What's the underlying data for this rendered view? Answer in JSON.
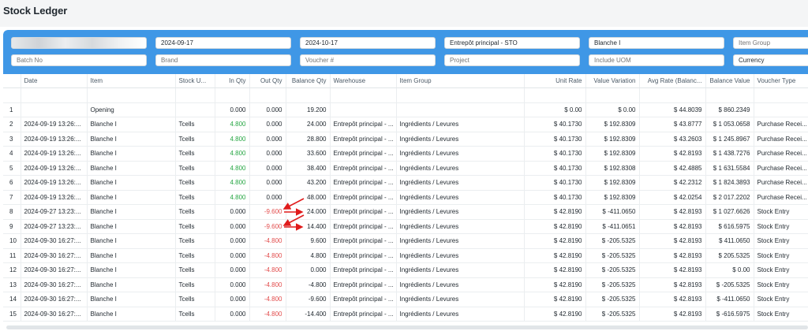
{
  "page": {
    "title": "Stock Ledger"
  },
  "filters": {
    "company": {
      "value": "Company",
      "blurred": true
    },
    "from_date": {
      "value": "2024-09-17"
    },
    "to_date": {
      "value": "2024-10-17"
    },
    "warehouse": {
      "value": "Entrepôt principal - STO"
    },
    "item": {
      "value": "Blanche I"
    },
    "item_group": {
      "placeholder": "Item Group"
    },
    "batch_no": {
      "placeholder": "Batch No"
    },
    "brand": {
      "placeholder": "Brand"
    },
    "voucher": {
      "placeholder": "Voucher #"
    },
    "project": {
      "placeholder": "Project"
    },
    "include_uom": {
      "placeholder": "Include UOM"
    },
    "currency": {
      "value": "Currency"
    }
  },
  "table": {
    "columns": [
      "",
      "Date",
      "Item",
      "Stock U...",
      "In Qty",
      "Out Qty",
      "Balance Qty",
      "Warehouse",
      "Item Group",
      "Unit Rate",
      "Value Variation",
      "Avg Rate (Balanc...",
      "Balance Value",
      "Voucher Type"
    ],
    "rows": [
      {
        "n": "1",
        "date": "",
        "item": "Opening",
        "uom": "",
        "in_qty": "0.000",
        "out_qty": "0.000",
        "bal_qty": "19.200",
        "warehouse": "",
        "item_group": "",
        "unit_rate": "$ 0.00",
        "value_var": "$ 0.00",
        "avg_rate": "$ 44.8039",
        "bal_value": "$ 860.2349",
        "voucher": ""
      },
      {
        "n": "2",
        "date": "2024-09-19 13:26:...",
        "item": "Blanche I",
        "uom": "Tcells",
        "in_qty": "4.800",
        "out_qty": "0.000",
        "bal_qty": "24.000",
        "warehouse": "Entrepôt principal - ...",
        "item_group": "Ingrédients / Levures",
        "unit_rate": "$ 40.1730",
        "value_var": "$ 192.8309",
        "avg_rate": "$ 43.8777",
        "bal_value": "$ 1 053.0658",
        "voucher": "Purchase Recei..."
      },
      {
        "n": "3",
        "date": "2024-09-19 13:26:...",
        "item": "Blanche I",
        "uom": "Tcells",
        "in_qty": "4.800",
        "out_qty": "0.000",
        "bal_qty": "28.800",
        "warehouse": "Entrepôt principal - ...",
        "item_group": "Ingrédients / Levures",
        "unit_rate": "$ 40.1730",
        "value_var": "$ 192.8309",
        "avg_rate": "$ 43.2603",
        "bal_value": "$ 1 245.8967",
        "voucher": "Purchase Recei..."
      },
      {
        "n": "4",
        "date": "2024-09-19 13:26:...",
        "item": "Blanche I",
        "uom": "Tcells",
        "in_qty": "4.800",
        "out_qty": "0.000",
        "bal_qty": "33.600",
        "warehouse": "Entrepôt principal - ...",
        "item_group": "Ingrédients / Levures",
        "unit_rate": "$ 40.1730",
        "value_var": "$ 192.8309",
        "avg_rate": "$ 42.8193",
        "bal_value": "$ 1 438.7276",
        "voucher": "Purchase Recei..."
      },
      {
        "n": "5",
        "date": "2024-09-19 13:26:...",
        "item": "Blanche I",
        "uom": "Tcells",
        "in_qty": "4.800",
        "out_qty": "0.000",
        "bal_qty": "38.400",
        "warehouse": "Entrepôt principal - ...",
        "item_group": "Ingrédients / Levures",
        "unit_rate": "$ 40.1730",
        "value_var": "$ 192.8308",
        "avg_rate": "$ 42.4885",
        "bal_value": "$ 1 631.5584",
        "voucher": "Purchase Recei..."
      },
      {
        "n": "6",
        "date": "2024-09-19 13:26:...",
        "item": "Blanche I",
        "uom": "Tcells",
        "in_qty": "4.800",
        "out_qty": "0.000",
        "bal_qty": "43.200",
        "warehouse": "Entrepôt principal - ...",
        "item_group": "Ingrédients / Levures",
        "unit_rate": "$ 40.1730",
        "value_var": "$ 192.8309",
        "avg_rate": "$ 42.2312",
        "bal_value": "$ 1 824.3893",
        "voucher": "Purchase Recei..."
      },
      {
        "n": "7",
        "date": "2024-09-19 13:26:...",
        "item": "Blanche I",
        "uom": "Tcells",
        "in_qty": "4.800",
        "out_qty": "0.000",
        "bal_qty": "48.000",
        "warehouse": "Entrepôt principal - ...",
        "item_group": "Ingrédients / Levures",
        "unit_rate": "$ 40.1730",
        "value_var": "$ 192.8309",
        "avg_rate": "$ 42.0254",
        "bal_value": "$ 2 017.2202",
        "voucher": "Purchase Recei..."
      },
      {
        "n": "8",
        "date": "2024-09-27 13:23:...",
        "item": "Blanche I",
        "uom": "Tcells",
        "in_qty": "0.000",
        "out_qty": "-9.600",
        "bal_qty": "24.000",
        "warehouse": "Entrepôt principal - ...",
        "item_group": "Ingrédients / Levures",
        "unit_rate": "$ 42.8190",
        "value_var": "$ -411.0650",
        "avg_rate": "$ 42.8193",
        "bal_value": "$ 1 027.6626",
        "voucher": "Stock Entry"
      },
      {
        "n": "9",
        "date": "2024-09-27 13:23:...",
        "item": "Blanche I",
        "uom": "Tcells",
        "in_qty": "0.000",
        "out_qty": "-9.600",
        "bal_qty": "14.400",
        "warehouse": "Entrepôt principal - ...",
        "item_group": "Ingrédients / Levures",
        "unit_rate": "$ 42.8190",
        "value_var": "$ -411.0651",
        "avg_rate": "$ 42.8193",
        "bal_value": "$ 616.5975",
        "voucher": "Stock Entry"
      },
      {
        "n": "10",
        "date": "2024-09-30 16:27:...",
        "item": "Blanche I",
        "uom": "Tcells",
        "in_qty": "0.000",
        "out_qty": "-4.800",
        "bal_qty": "9.600",
        "warehouse": "Entrepôt principal - ...",
        "item_group": "Ingrédients / Levures",
        "unit_rate": "$ 42.8190",
        "value_var": "$ -205.5325",
        "avg_rate": "$ 42.8193",
        "bal_value": "$ 411.0650",
        "voucher": "Stock Entry"
      },
      {
        "n": "11",
        "date": "2024-09-30 16:27:...",
        "item": "Blanche I",
        "uom": "Tcells",
        "in_qty": "0.000",
        "out_qty": "-4.800",
        "bal_qty": "4.800",
        "warehouse": "Entrepôt principal - ...",
        "item_group": "Ingrédients / Levures",
        "unit_rate": "$ 42.8190",
        "value_var": "$ -205.5325",
        "avg_rate": "$ 42.8193",
        "bal_value": "$ 205.5325",
        "voucher": "Stock Entry"
      },
      {
        "n": "12",
        "date": "2024-09-30 16:27:...",
        "item": "Blanche I",
        "uom": "Tcells",
        "in_qty": "0.000",
        "out_qty": "-4.800",
        "bal_qty": "0.000",
        "warehouse": "Entrepôt principal - ...",
        "item_group": "Ingrédients / Levures",
        "unit_rate": "$ 42.8190",
        "value_var": "$ -205.5325",
        "avg_rate": "$ 42.8193",
        "bal_value": "$ 0.00",
        "voucher": "Stock Entry"
      },
      {
        "n": "13",
        "date": "2024-09-30 16:27:...",
        "item": "Blanche I",
        "uom": "Tcells",
        "in_qty": "0.000",
        "out_qty": "-4.800",
        "bal_qty": "-4.800",
        "warehouse": "Entrepôt principal - ...",
        "item_group": "Ingrédients / Levures",
        "unit_rate": "$ 42.8190",
        "value_var": "$ -205.5325",
        "avg_rate": "$ 42.8193",
        "bal_value": "$ -205.5325",
        "voucher": "Stock Entry"
      },
      {
        "n": "14",
        "date": "2024-09-30 16:27:...",
        "item": "Blanche I",
        "uom": "Tcells",
        "in_qty": "0.000",
        "out_qty": "-4.800",
        "bal_qty": "-9.600",
        "warehouse": "Entrepôt principal - ...",
        "item_group": "Ingrédients / Levures",
        "unit_rate": "$ 42.8190",
        "value_var": "$ -205.5325",
        "avg_rate": "$ 42.8193",
        "bal_value": "$ -411.0650",
        "voucher": "Stock Entry"
      },
      {
        "n": "15",
        "date": "2024-09-30 16:27:...",
        "item": "Blanche I",
        "uom": "Tcells",
        "in_qty": "0.000",
        "out_qty": "-4.800",
        "bal_qty": "-14.400",
        "warehouse": "Entrepôt principal - ...",
        "item_group": "Ingrédients / Levures",
        "unit_rate": "$ 42.8190",
        "value_var": "$ -205.5325",
        "avg_rate": "$ 42.8193",
        "bal_value": "$ -616.5975",
        "voucher": "Stock Entry"
      }
    ]
  },
  "annotations": {
    "arrow_color": "#e01b1b"
  },
  "colors": {
    "header_band": "#3f97e6",
    "in_qty": "#28a745",
    "out_qty": "#e24c4c"
  }
}
